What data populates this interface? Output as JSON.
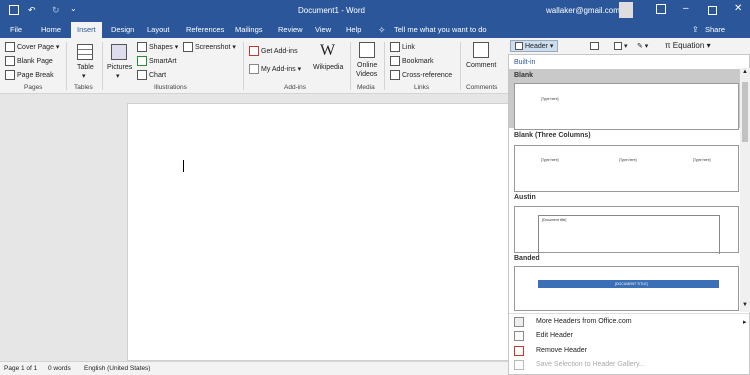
{
  "titlebar": {
    "doc_title": "Document1  -  Word",
    "account": "wallaker@gmail.com",
    "tell_me": "Tell me what you want to do",
    "share": "Share"
  },
  "tabs": [
    "File",
    "Home",
    "Insert",
    "Design",
    "Layout",
    "References",
    "Mailings",
    "Review",
    "View",
    "Help"
  ],
  "active_tab": "Insert",
  "ribbon": {
    "pages": {
      "cover_page": "Cover Page",
      "blank_page": "Blank Page",
      "page_break": "Page Break",
      "group": "Pages"
    },
    "tables": {
      "table": "Table",
      "group": "Tables"
    },
    "illustrations": {
      "pictures": "Pictures",
      "shapes": "Shapes",
      "smartart": "SmartArt",
      "chart": "Chart",
      "screenshot": "Screenshot",
      "group": "Illustrations"
    },
    "addins": {
      "get_addins": "Get Add-ins",
      "my_addins": "My Add-ins",
      "wikipedia": "Wikipedia",
      "group": "Add-ins"
    },
    "media": {
      "online_videos_1": "Online",
      "online_videos_2": "Videos",
      "group": "Media"
    },
    "links": {
      "link": "Link",
      "bookmark": "Bookmark",
      "cross_reference": "Cross-reference",
      "group": "Links"
    },
    "comments": {
      "comment": "Comment",
      "group": "Comments"
    },
    "header_fragment": {
      "header": "Header",
      "equation": "Equation"
    }
  },
  "dropdown": {
    "builtin_label": "Built-in",
    "galleries": [
      {
        "name": "Blank",
        "placeholders": [
          "[Type here]"
        ]
      },
      {
        "name": "Blank (Three Columns)",
        "placeholders": [
          "[Type here]",
          "[Type here]",
          "[Type here]"
        ]
      },
      {
        "name": "Austin",
        "placeholders": [
          "[Document title]"
        ]
      },
      {
        "name": "Banded",
        "placeholders": [
          "[DOCUMENT TITLE]"
        ]
      }
    ],
    "menu": {
      "more_headers": "More Headers from Office.com",
      "edit_header": "Edit Header",
      "remove_header": "Remove Header",
      "save_selection": "Save Selection to Header Gallery..."
    }
  },
  "statusbar": {
    "page": "Page 1 of 1",
    "words": "0 words",
    "language": "English (United States)"
  },
  "colors": {
    "brand": "#2b579a",
    "ribbon_bg": "#f3f3f3",
    "banded_bar": "#3b6fb6"
  }
}
